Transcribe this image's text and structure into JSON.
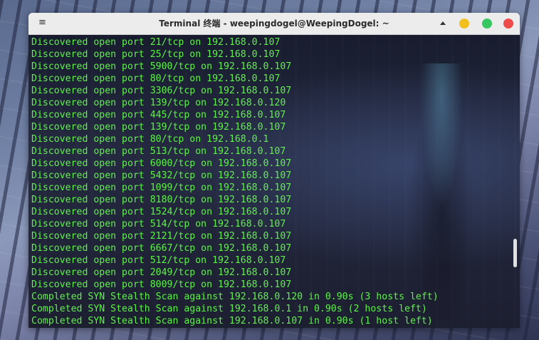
{
  "window": {
    "title": "Terminal 终端 - weepingdogel@WeepingDogel: ~",
    "menu_icon": "hamburger-menu-icon",
    "buttons": {
      "collapse": "chevron-up-icon",
      "minimize_color": "#f2c01e",
      "maximize_color": "#37c760",
      "close_color": "#ee4b4b"
    }
  },
  "terminal": {
    "text_color": "#5ef24a",
    "lines": [
      "Discovered open port 21/tcp on 192.168.0.107",
      "Discovered open port 25/tcp on 192.168.0.107",
      "Discovered open port 5900/tcp on 192.168.0.107",
      "Discovered open port 80/tcp on 192.168.0.107",
      "Discovered open port 3306/tcp on 192.168.0.107",
      "Discovered open port 139/tcp on 192.168.0.120",
      "Discovered open port 445/tcp on 192.168.0.107",
      "Discovered open port 139/tcp on 192.168.0.107",
      "Discovered open port 80/tcp on 192.168.0.1",
      "Discovered open port 513/tcp on 192.168.0.107",
      "Discovered open port 6000/tcp on 192.168.0.107",
      "Discovered open port 5432/tcp on 192.168.0.107",
      "Discovered open port 1099/tcp on 192.168.0.107",
      "Discovered open port 8180/tcp on 192.168.0.107",
      "Discovered open port 1524/tcp on 192.168.0.107",
      "Discovered open port 514/tcp on 192.168.0.107",
      "Discovered open port 2121/tcp on 192.168.0.107",
      "Discovered open port 6667/tcp on 192.168.0.107",
      "Discovered open port 512/tcp on 192.168.0.107",
      "Discovered open port 2049/tcp on 192.168.0.107",
      "Discovered open port 8009/tcp on 192.168.0.107",
      "Completed SYN Stealth Scan against 192.168.0.120 in 0.90s (3 hosts left)",
      "Completed SYN Stealth Scan against 192.168.0.1 in 0.90s (2 hosts left)",
      "Completed SYN Stealth Scan against 192.168.0.107 in 0.90s (1 host left)"
    ]
  }
}
